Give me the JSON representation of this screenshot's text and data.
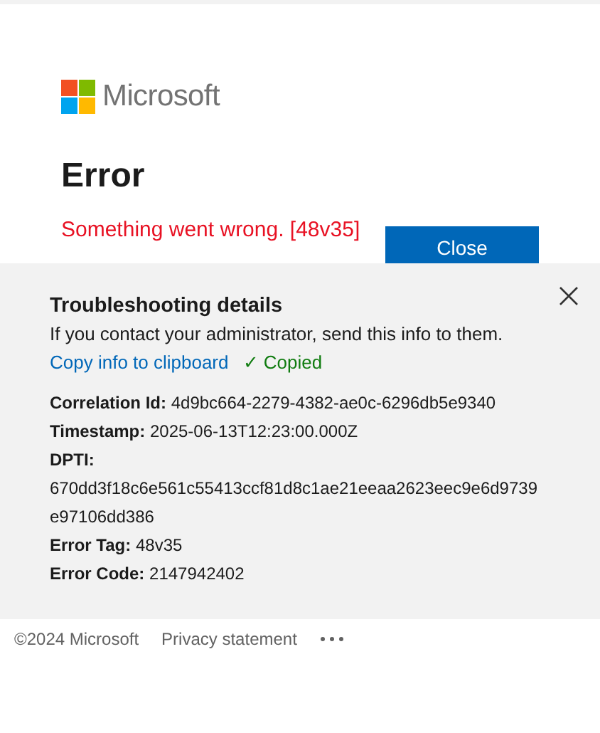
{
  "brand": {
    "name": "Microsoft"
  },
  "title": "Error",
  "message": "Something went wrong. [48v35]",
  "close_button": "Close",
  "troubleshooting": {
    "title": "Troubleshooting details",
    "description": "If you contact your administrator, send this info to them.",
    "copy_link": "Copy info to clipboard",
    "copied_status": "✓ Copied",
    "details": [
      {
        "kind": "inline",
        "label": "Correlation Id:",
        "value": "4d9bc664-2279-4382-ae0c-6296db5e9340"
      },
      {
        "kind": "inline",
        "label": "Timestamp:",
        "value": "2025-06-13T12:23:00.000Z"
      },
      {
        "kind": "block",
        "label": "DPTI:",
        "value": "670dd3f18c6e561c55413ccf81d8c1ae21eeaa2623eec9e6d9739e97106dd386"
      },
      {
        "kind": "inline",
        "label": "Error Tag:",
        "value": "48v35"
      },
      {
        "kind": "inline",
        "label": "Error Code:",
        "value": "2147942402"
      }
    ]
  },
  "footer": {
    "copyright": "©2024 Microsoft",
    "links": [
      "Privacy statement"
    ]
  }
}
